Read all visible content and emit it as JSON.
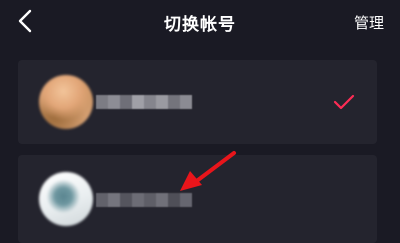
{
  "header": {
    "title": "切换帐号",
    "manage_label": "管理"
  },
  "accounts": [
    {
      "selected": true
    },
    {
      "selected": false
    }
  ],
  "colors": {
    "background": "#1a1a24",
    "card": "#24242e",
    "text": "#ffffff",
    "accent": "#fe2c55"
  },
  "icons": {
    "back": "chevron-left-icon",
    "selected": "check-icon",
    "pointer": "red-arrow-icon"
  }
}
